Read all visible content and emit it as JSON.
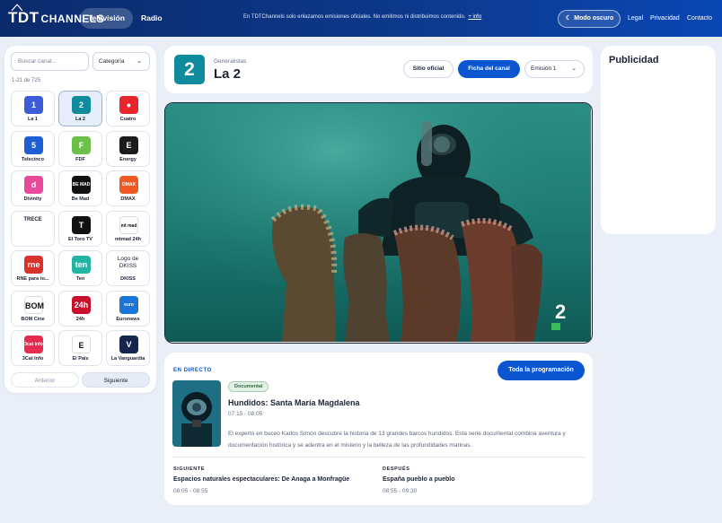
{
  "header": {
    "logo_main": "TDT",
    "logo_sub": "CHANNELS",
    "nav": [
      {
        "label": "Televisión",
        "active": true
      },
      {
        "label": "Radio",
        "active": false
      }
    ],
    "notice": "En TDTChannels solo enlazamos emisiones oficiales. No emitimos ni distribuimos contenido.",
    "notice_link": "+ info",
    "dark_mode_label": "Modo oscuro",
    "links": [
      "Legal",
      "Privacidad",
      "Contacto"
    ],
    "accent": "#0b55d0"
  },
  "sidebar": {
    "search_placeholder": "Buscar canal...",
    "category_label": "Categoría",
    "count": "1-21 de 725",
    "prev_label": "Anterior",
    "next_label": "Siguiente",
    "channels": [
      {
        "name": "La 1",
        "icon": "1",
        "color": "#3b5bd9"
      },
      {
        "name": "La 2",
        "icon": "2",
        "color": "#0e8b9c",
        "selected": true
      },
      {
        "name": "Cuatro",
        "icon": "●",
        "color": "#e8252d"
      },
      {
        "name": "Telecinco",
        "icon": "5",
        "color": "#1e5fd6"
      },
      {
        "name": "FDF",
        "icon": "F",
        "color": "#6cc04a"
      },
      {
        "name": "Energy",
        "icon": "E",
        "color": "#1b1b1b"
      },
      {
        "name": "Divinity",
        "icon": "d",
        "color": "#e9499a"
      },
      {
        "name": "Be Mad",
        "icon": "BE MAD",
        "color": "#111111"
      },
      {
        "name": "DMAX",
        "icon": "DMAX",
        "color": "#ef5a24"
      },
      {
        "name": "TRECE",
        "icon": "",
        "color": ""
      },
      {
        "name": "El Toro TV",
        "icon": "T",
        "color": "#111111"
      },
      {
        "name": "mtmad 24h",
        "icon": "mt mad",
        "color": "#ffffff"
      },
      {
        "name": "RNE para to...",
        "icon": "rne",
        "color": "#d8322f"
      },
      {
        "name": "Ten",
        "icon": "ten",
        "color": "#23b4a4"
      },
      {
        "name": "DKISS",
        "icon": "Logo de DKISS",
        "color": ""
      },
      {
        "name": "BOM Cine",
        "icon": "BOM",
        "color": "#ffffff"
      },
      {
        "name": "24h",
        "icon": "24h",
        "color": "#c8102e"
      },
      {
        "name": "Euronews",
        "icon": "euro news.",
        "color": "#1e73d6"
      },
      {
        "name": "3Cat Info",
        "icon": "3cat info",
        "color": "#e52b50"
      },
      {
        "name": "El País",
        "icon": "E",
        "color": "#ffffff"
      },
      {
        "name": "La Vanguardia",
        "icon": "V",
        "color": "#16254d"
      }
    ]
  },
  "channel": {
    "category": "Generalistas",
    "name": "La 2",
    "logo_text": "2",
    "official_site_label": "Sitio oficial",
    "sheet_label": "Ficha del canal",
    "emission_label": "Emisión 1"
  },
  "video": {
    "watermark": "2"
  },
  "now": {
    "live_label": "EN DIRECTO",
    "all_programs_label": "Toda la programación",
    "genre": "Documental",
    "title": "Hundidos: Santa María Magdalena",
    "time": "07:15 - 08:05",
    "description": "El experto en buceo Karlos Simón descubre la historia de 13 grandes barcos hundidos. Esta serie documental combina aventura y documentación histórica y se adentra en el misterio y la belleza de las profundidades marinas.",
    "next": {
      "label": "SIGUIENTE",
      "title": "Espacios naturales espectaculares: De Anaga a Monfragüe",
      "time": "08:05 - 08:55"
    },
    "after": {
      "label": "DESPUÉS",
      "title": "España pueblo a pueblo",
      "time": "08:55 - 09:30"
    }
  },
  "ad": {
    "title": "Publicidad"
  }
}
